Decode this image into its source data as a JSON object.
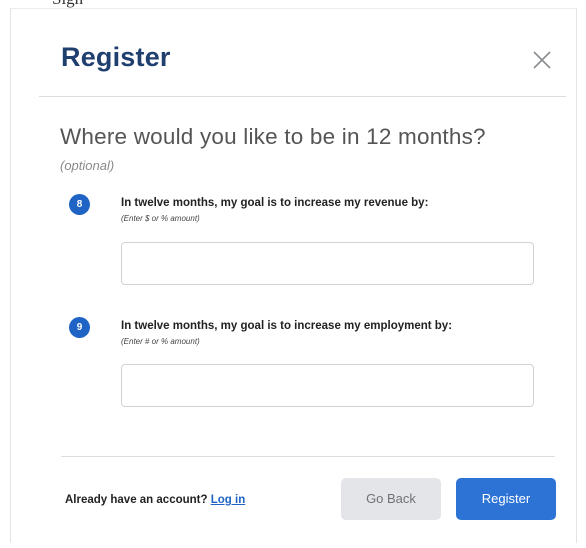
{
  "top_clip_text": "Sign",
  "modal": {
    "title": "Register",
    "close_icon": "close-icon"
  },
  "section": {
    "title": "Where would you like to be in 12 months?",
    "optional": "(optional)"
  },
  "questions": [
    {
      "number": "8",
      "label": "In twelve months, my goal is to increase my revenue by:",
      "hint": "(Enter $ or % amount)",
      "value": ""
    },
    {
      "number": "9",
      "label": "In twelve months, my goal is to increase my employment by:",
      "hint": "(Enter # or % amount)",
      "value": ""
    }
  ],
  "footer": {
    "account_prompt": "Already have an account?",
    "login_link": "Log in",
    "back_label": "Go Back",
    "register_label": "Register"
  },
  "colors": {
    "title": "#1f3f6e",
    "badge": "#1f63c4",
    "primary_button": "#2d73d6",
    "secondary_button": "#e3e5e8",
    "link": "#1f63c4"
  }
}
